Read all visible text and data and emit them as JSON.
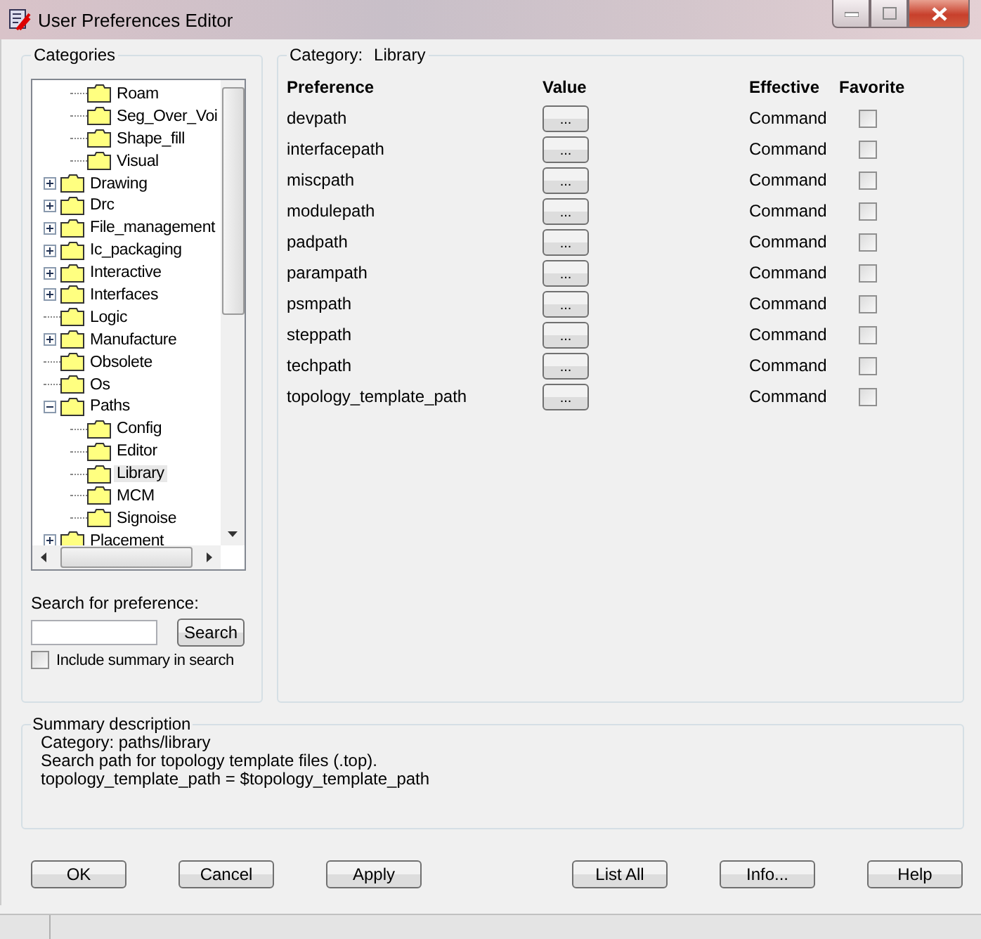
{
  "window": {
    "title": "User Preferences Editor"
  },
  "categories": {
    "title": "Categories",
    "continued_children": [
      {
        "label": "Roam",
        "selected": false
      },
      {
        "label": "Seg_Over_Voi",
        "selected": false
      },
      {
        "label": "Shape_fill",
        "selected": false
      },
      {
        "label": "Visual",
        "selected": false
      }
    ],
    "items": [
      {
        "label": "Drawing",
        "selected": false,
        "expanded": false
      },
      {
        "label": "Drc",
        "selected": false,
        "expanded": false
      },
      {
        "label": "File_management",
        "selected": false,
        "expanded": false
      },
      {
        "label": "Ic_packaging",
        "selected": false,
        "expanded": false
      },
      {
        "label": "Interactive",
        "selected": false,
        "expanded": false
      },
      {
        "label": "Interfaces",
        "selected": false,
        "expanded": false
      },
      {
        "label": "Logic",
        "selected": false
      },
      {
        "label": "Manufacture",
        "selected": false,
        "expanded": false
      },
      {
        "label": "Obsolete",
        "selected": false
      },
      {
        "label": "Os",
        "selected": false
      },
      {
        "label": "Paths",
        "selected": false,
        "expanded": true,
        "children": [
          {
            "label": "Config",
            "selected": false
          },
          {
            "label": "Editor",
            "selected": false
          },
          {
            "label": "Library",
            "selected": true
          },
          {
            "label": "MCM",
            "selected": false
          },
          {
            "label": "Signoise",
            "selected": false
          }
        ]
      },
      {
        "label": "Placement",
        "selected": false,
        "expanded": false
      }
    ]
  },
  "search": {
    "label": "Search for preference:",
    "button": "Search",
    "include_summary": {
      "label": "Include summary in search",
      "checked": false
    }
  },
  "preferences": {
    "category_label": "Category:",
    "category": "Library",
    "columns": [
      "Preference",
      "Value",
      "Effective",
      "Favorite"
    ],
    "rows": [
      {
        "name": "devpath",
        "value_button": "...",
        "effective": "Command",
        "favorite": false
      },
      {
        "name": "interfacepath",
        "value_button": "...",
        "effective": "Command",
        "favorite": false
      },
      {
        "name": "miscpath",
        "value_button": "...",
        "effective": "Command",
        "favorite": false
      },
      {
        "name": "modulepath",
        "value_button": "...",
        "effective": "Command",
        "favorite": false
      },
      {
        "name": "padpath",
        "value_button": "...",
        "effective": "Command",
        "favorite": false
      },
      {
        "name": "parampath",
        "value_button": "...",
        "effective": "Command",
        "favorite": false
      },
      {
        "name": "psmpath",
        "value_button": "...",
        "effective": "Command",
        "favorite": false
      },
      {
        "name": "steppath",
        "value_button": "...",
        "effective": "Command",
        "favorite": false
      },
      {
        "name": "techpath",
        "value_button": "...",
        "effective": "Command",
        "favorite": false
      },
      {
        "name": "topology_template_path",
        "value_button": "...",
        "effective": "Command",
        "favorite": false
      }
    ]
  },
  "summary": {
    "title": "Summary description",
    "lines": [
      "Category: paths/library",
      "Search path for topology template files (.top).",
      "topology_template_path = $topology_template_path"
    ]
  },
  "buttons": [
    "OK",
    "Cancel",
    "Apply",
    "List All",
    "Info...",
    "Help"
  ]
}
